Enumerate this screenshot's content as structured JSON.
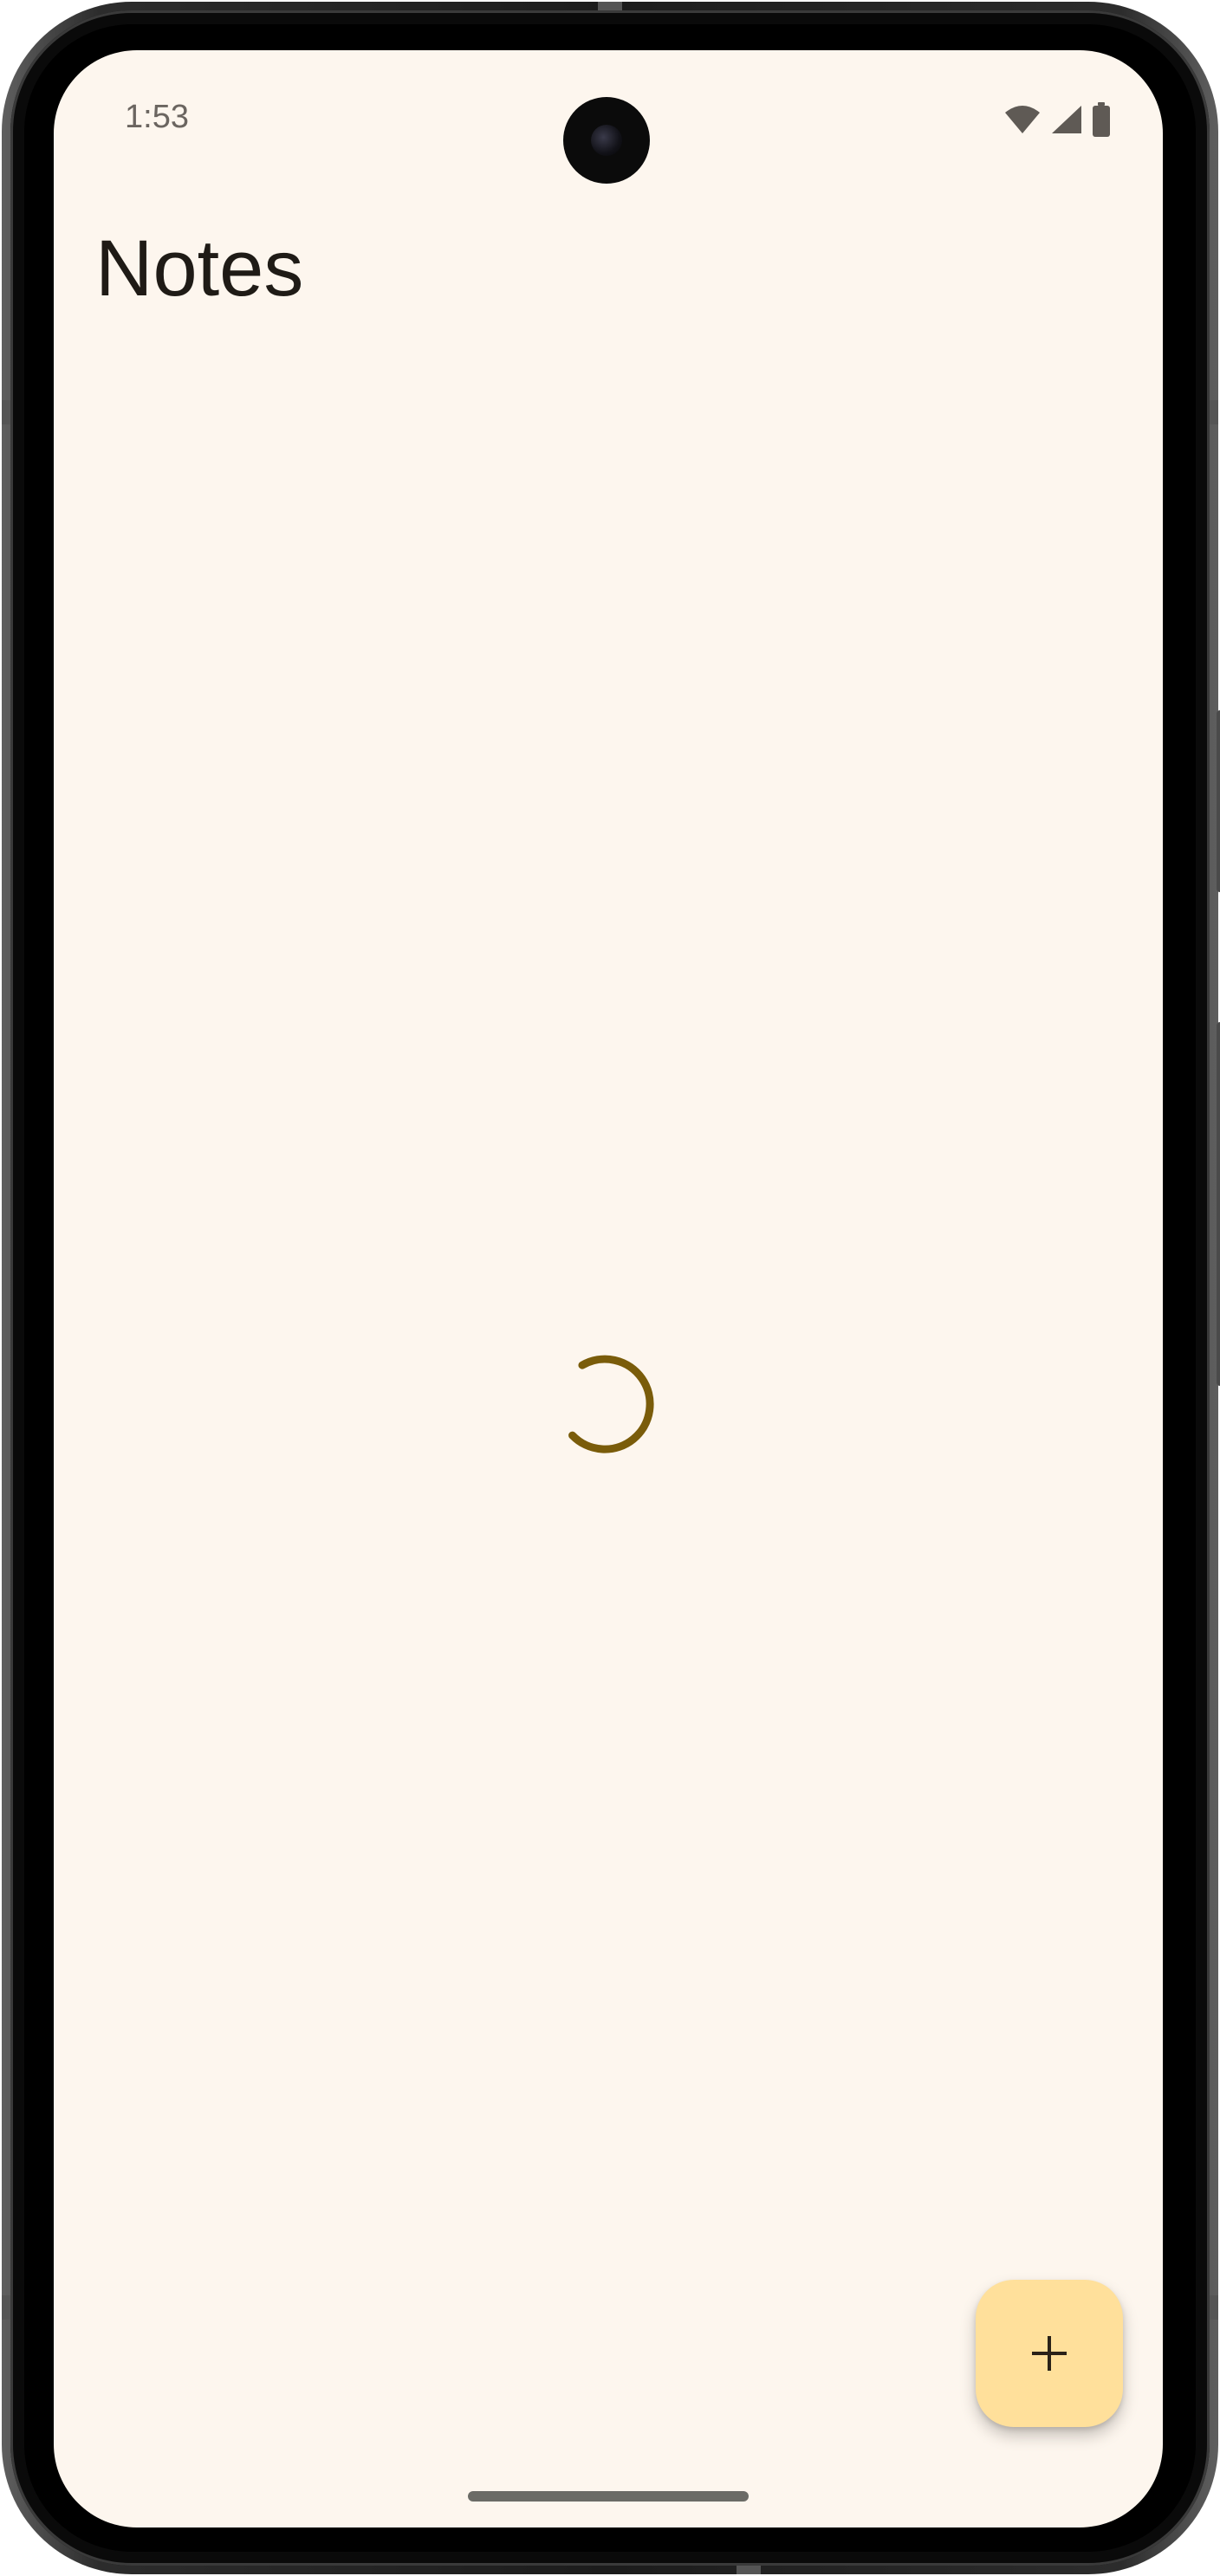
{
  "status_bar": {
    "time": "1:53",
    "icons": [
      "wifi-icon",
      "cellular-signal-icon",
      "battery-icon"
    ]
  },
  "app": {
    "title": "Notes"
  },
  "loading": {
    "indicator": "circular-progress-spinner",
    "color": "#7a5c0a"
  },
  "fab": {
    "icon": "plus-icon",
    "color": "#ffe09b"
  },
  "colors": {
    "background": "#fdf6ee",
    "title_text": "#1f1b16",
    "accent": "#7a5c0a"
  }
}
